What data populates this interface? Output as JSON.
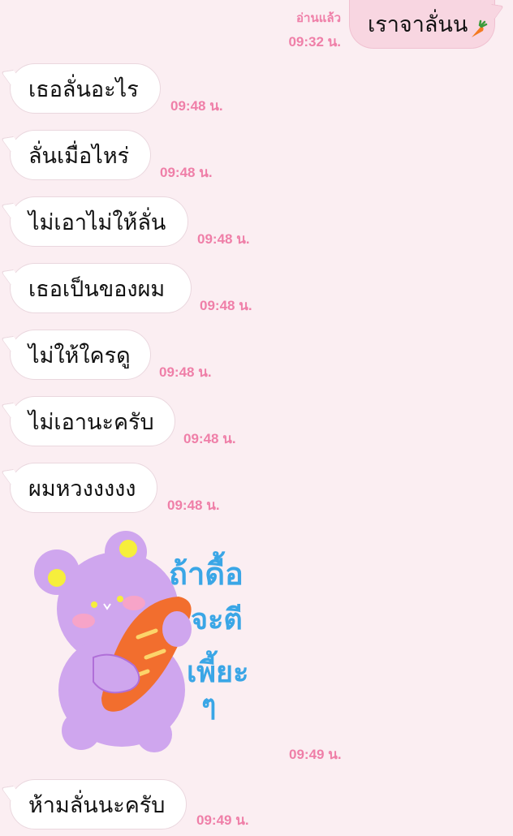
{
  "outgoing": {
    "text": "เราจาลั่นน",
    "read_label": "อ่านแล้ว",
    "time": "09:32 น.",
    "emoji_icon": "carrot-icon"
  },
  "messages": [
    {
      "text": "เธอลั่นอะไร",
      "time": "09:48 น."
    },
    {
      "text": "ลั่นเมื่อไหร่",
      "time": "09:48 น."
    },
    {
      "text": "ไม่เอาไม่ให้ลั่น",
      "time": "09:48 น."
    },
    {
      "text": "เธอเป็นของผม",
      "time": "09:48 น."
    },
    {
      "text": "ไม่ให้ใครดู",
      "time": "09:48 น."
    },
    {
      "text": "ไม่เอานะครับ",
      "time": "09:48 น."
    },
    {
      "text": "ผมหวงงงงง",
      "time": "09:48 น."
    }
  ],
  "sticker": {
    "lines": [
      "ถ้าดื้อ",
      "จะตี",
      "เพี้ยะ",
      "ๆ"
    ],
    "time": "09:49 น.",
    "icon": "purple-bear-baguette-sticker",
    "colors": {
      "bear": "#cfa6ee",
      "bread": "#f26e2e",
      "text": "#3aa6e6"
    }
  },
  "last_message": {
    "text": "ห้ามลั่นนะครับ",
    "time": "09:49 น."
  }
}
